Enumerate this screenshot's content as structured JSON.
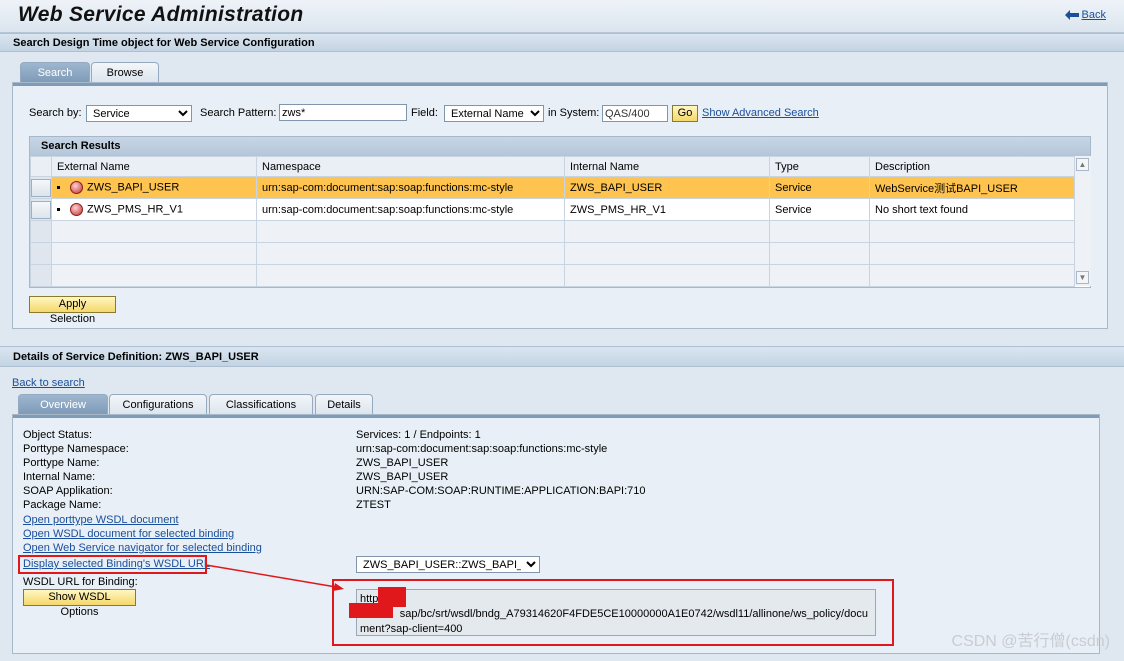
{
  "header": {
    "title": "Web Service Administration",
    "back_label": "Back"
  },
  "search_section": {
    "title": "Search Design Time object for Web Service Configuration",
    "tabs": [
      {
        "label": "Search",
        "active": true
      },
      {
        "label": "Browse",
        "active": false
      }
    ],
    "search_by_label": "Search by:",
    "search_by_value": "Service",
    "pattern_label": "Search Pattern:",
    "pattern_value": "zws*",
    "field_label": "Field:",
    "field_value": "External Name",
    "system_label": "in System:",
    "system_value": "QAS/400",
    "go_label": "Go",
    "advanced_link": "Show Advanced Search",
    "results_title": "Search Results",
    "columns": [
      "External Name",
      "Namespace",
      "Internal Name",
      "Type",
      "Description"
    ],
    "rows": [
      {
        "external": "ZWS_BAPI_USER",
        "namespace": "urn:sap-com:document:sap:soap:functions:mc-style",
        "internal": "ZWS_BAPI_USER",
        "type": "Service",
        "description": "WebService测试BAPI_USER"
      },
      {
        "external": "ZWS_PMS_HR_V1",
        "namespace": "urn:sap-com:document:sap:soap:functions:mc-style",
        "internal": "ZWS_PMS_HR_V1",
        "type": "Service",
        "description": "No short text found"
      }
    ],
    "apply_label": "Apply Selection"
  },
  "details_section": {
    "title": "Details of Service Definition: ZWS_BAPI_USER",
    "back_to_search": "Back to search",
    "tabs": [
      {
        "label": "Overview",
        "active": true
      },
      {
        "label": "Configurations",
        "active": false
      },
      {
        "label": "Classifications",
        "active": false
      },
      {
        "label": "Details",
        "active": false
      }
    ],
    "fields": [
      {
        "label": "Object Status:",
        "value": "Services: 1 / Endpoints: 1"
      },
      {
        "label": "Porttype Namespace:",
        "value": "urn:sap-com:document:sap:soap:functions:mc-style"
      },
      {
        "label": "Porttype Name:",
        "value": "ZWS_BAPI_USER"
      },
      {
        "label": "Internal Name:",
        "value": "ZWS_BAPI_USER"
      },
      {
        "label": "SOAP Applikation:",
        "value": "URN:SAP-COM:SOAP:RUNTIME:APPLICATION:BAPI:710"
      },
      {
        "label": "Package Name:",
        "value": "ZTEST"
      }
    ],
    "links": [
      "Open porttype WSDL document",
      "Open WSDL document for selected binding",
      "Open Web Service navigator for selected binding"
    ],
    "display_wsdl_link": "Display selected Binding's WSDL URL",
    "binding_select": "ZWS_BAPI_USER::ZWS_BAPI_...",
    "wsdl_url_label": "WSDL URL for Binding:",
    "show_wsdl_options": "Show WSDL Options",
    "wsdl_url_lines": [
      "http        -",
      "             sap/bc/srt/wsdl/bndg_A79314620F4FDE5CE10000000A1E0742/wsdl11/allinone/ws_policy/docu",
      "ment?sap-client=400"
    ]
  },
  "watermark": "CSDN @苦行僧(csdn)",
  "colors": {
    "highlight_row": "#fec44f",
    "annotation_red": "#e0181c",
    "link": "#1a4f9c"
  }
}
